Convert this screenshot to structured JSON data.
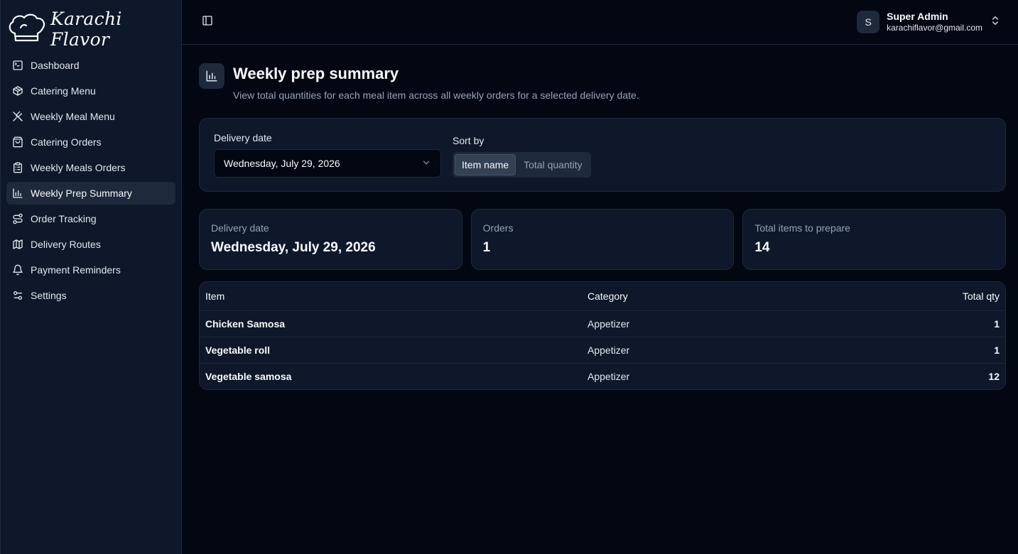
{
  "brand": {
    "name": "Karachi Flavor",
    "icon": "chef-hat-icon"
  },
  "sidebar": {
    "items": [
      {
        "label": "Dashboard",
        "icon": "terminal-square-icon",
        "active": false
      },
      {
        "label": "Catering Menu",
        "icon": "package-icon",
        "active": false
      },
      {
        "label": "Weekly Meal Menu",
        "icon": "utensils-crossed-icon",
        "active": false
      },
      {
        "label": "Catering Orders",
        "icon": "shopping-bag-icon",
        "active": false
      },
      {
        "label": "Weekly Meals Orders",
        "icon": "clipboard-list-icon",
        "active": false
      },
      {
        "label": "Weekly Prep Summary",
        "icon": "bar-chart-icon",
        "active": true
      },
      {
        "label": "Order Tracking",
        "icon": "route-icon",
        "active": false
      },
      {
        "label": "Delivery Routes",
        "icon": "map-icon",
        "active": false
      },
      {
        "label": "Payment Reminders",
        "icon": "bell-icon",
        "active": false
      },
      {
        "label": "Settings",
        "icon": "sliders-icon",
        "active": false
      }
    ]
  },
  "topbar": {
    "user": {
      "initial": "S",
      "name": "Super Admin",
      "email": "karachiflavor@gmail.com"
    }
  },
  "page": {
    "title": "Weekly prep summary",
    "subtitle": "View total quantities for each meal item across all weekly orders for a selected delivery date."
  },
  "filters": {
    "delivery_date_label": "Delivery date",
    "delivery_date_value": "Wednesday, July 29, 2026",
    "sort_label": "Sort by",
    "sort_options": [
      "Item name",
      "Total quantity"
    ],
    "sort_selected": "Item name"
  },
  "stats": {
    "delivery_date": {
      "label": "Delivery date",
      "value": "Wednesday, July 29, 2026"
    },
    "orders": {
      "label": "Orders",
      "value": "1"
    },
    "total_items": {
      "label": "Total items to prepare",
      "value": "14"
    }
  },
  "table": {
    "headers": {
      "item": "Item",
      "category": "Category",
      "qty": "Total qty"
    },
    "rows": [
      {
        "item": "Chicken Samosa",
        "category": "Appetizer",
        "qty": "1"
      },
      {
        "item": "Vegetable roll",
        "category": "Appetizer",
        "qty": "1"
      },
      {
        "item": "Vegetable samosa",
        "category": "Appetizer",
        "qty": "12"
      }
    ]
  }
}
